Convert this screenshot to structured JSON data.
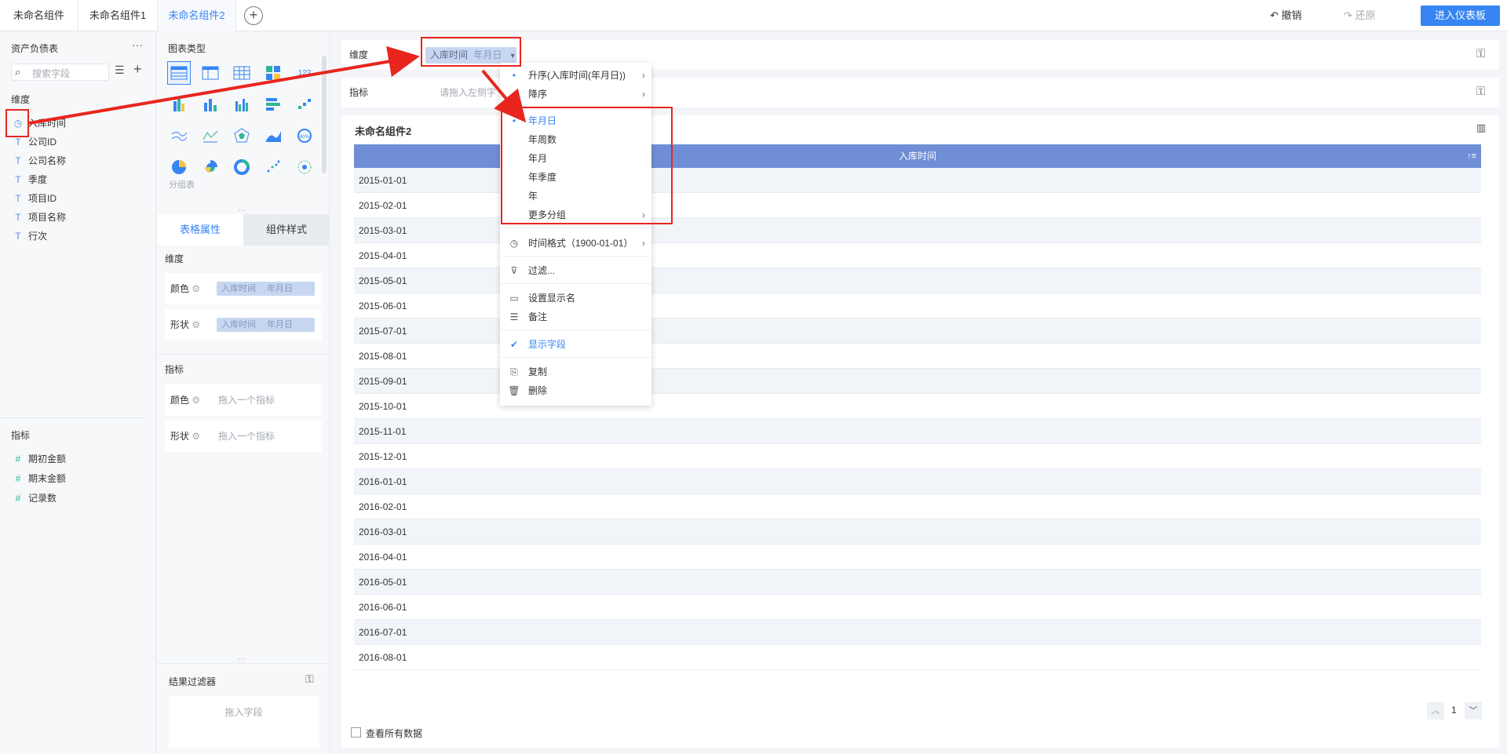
{
  "tabs": [
    "未命名组件",
    "未命名组件1",
    "未命名组件2"
  ],
  "toolbar": {
    "undo": "撤销",
    "redo": "还原",
    "enter": "进入仪表板"
  },
  "left": {
    "title": "资产负债表",
    "search_placeholder": "搜索字段",
    "dim_title": "维度",
    "dims": [
      "入库时间",
      "公司ID",
      "公司名称",
      "季度",
      "项目ID",
      "项目名称",
      "行次"
    ],
    "measure_title": "指标",
    "measures": [
      "期初金额",
      "期末金额",
      "记录数"
    ]
  },
  "mid": {
    "chart_type_title": "图表类型",
    "group_table_label": "分组表",
    "tab_props": "表格属性",
    "tab_style": "组件样式",
    "dim_title": "维度",
    "color_label": "颜色",
    "shape_label": "形状",
    "chip_field": "入库时间",
    "chip_unit": "年月日",
    "measure_title": "指标",
    "drag_measure": "拖入一个指标",
    "result_filter": "结果过滤器",
    "drag_field": "拖入字段"
  },
  "main": {
    "dim_label": "维度",
    "measure_label": "指标",
    "dim_chip_field": "入库时间",
    "dim_chip_unit": "年月日",
    "measure_placeholder": "请拖入左侧字",
    "component_title": "未命名组件2",
    "column_header": "入库时间",
    "rows": [
      "2015-01-01",
      "2015-02-01",
      "2015-03-01",
      "2015-04-01",
      "2015-05-01",
      "2015-06-01",
      "2015-07-01",
      "2015-08-01",
      "2015-09-01",
      "2015-10-01",
      "2015-11-01",
      "2015-12-01",
      "2016-01-01",
      "2016-02-01",
      "2016-03-01",
      "2016-04-01",
      "2016-05-01",
      "2016-06-01",
      "2016-07-01",
      "2016-08-01"
    ],
    "page_number": "1",
    "view_all": "查看所有数据"
  },
  "menu": {
    "sort_asc": "升序(入库时间(年月日))",
    "sort_desc": "降序",
    "groups": [
      "年月日",
      "年周数",
      "年月",
      "年季度",
      "年",
      "更多分组"
    ],
    "time_format": "时间格式（1900-01-01）",
    "filter": "过滤...",
    "set_display_name": "设置显示名",
    "note": "备注",
    "show_field": "显示字段",
    "copy": "复制",
    "delete": "删除"
  },
  "colors": {
    "accent": "#3685f2",
    "header": "#6f8ed5",
    "annotation": "#e8261e"
  }
}
